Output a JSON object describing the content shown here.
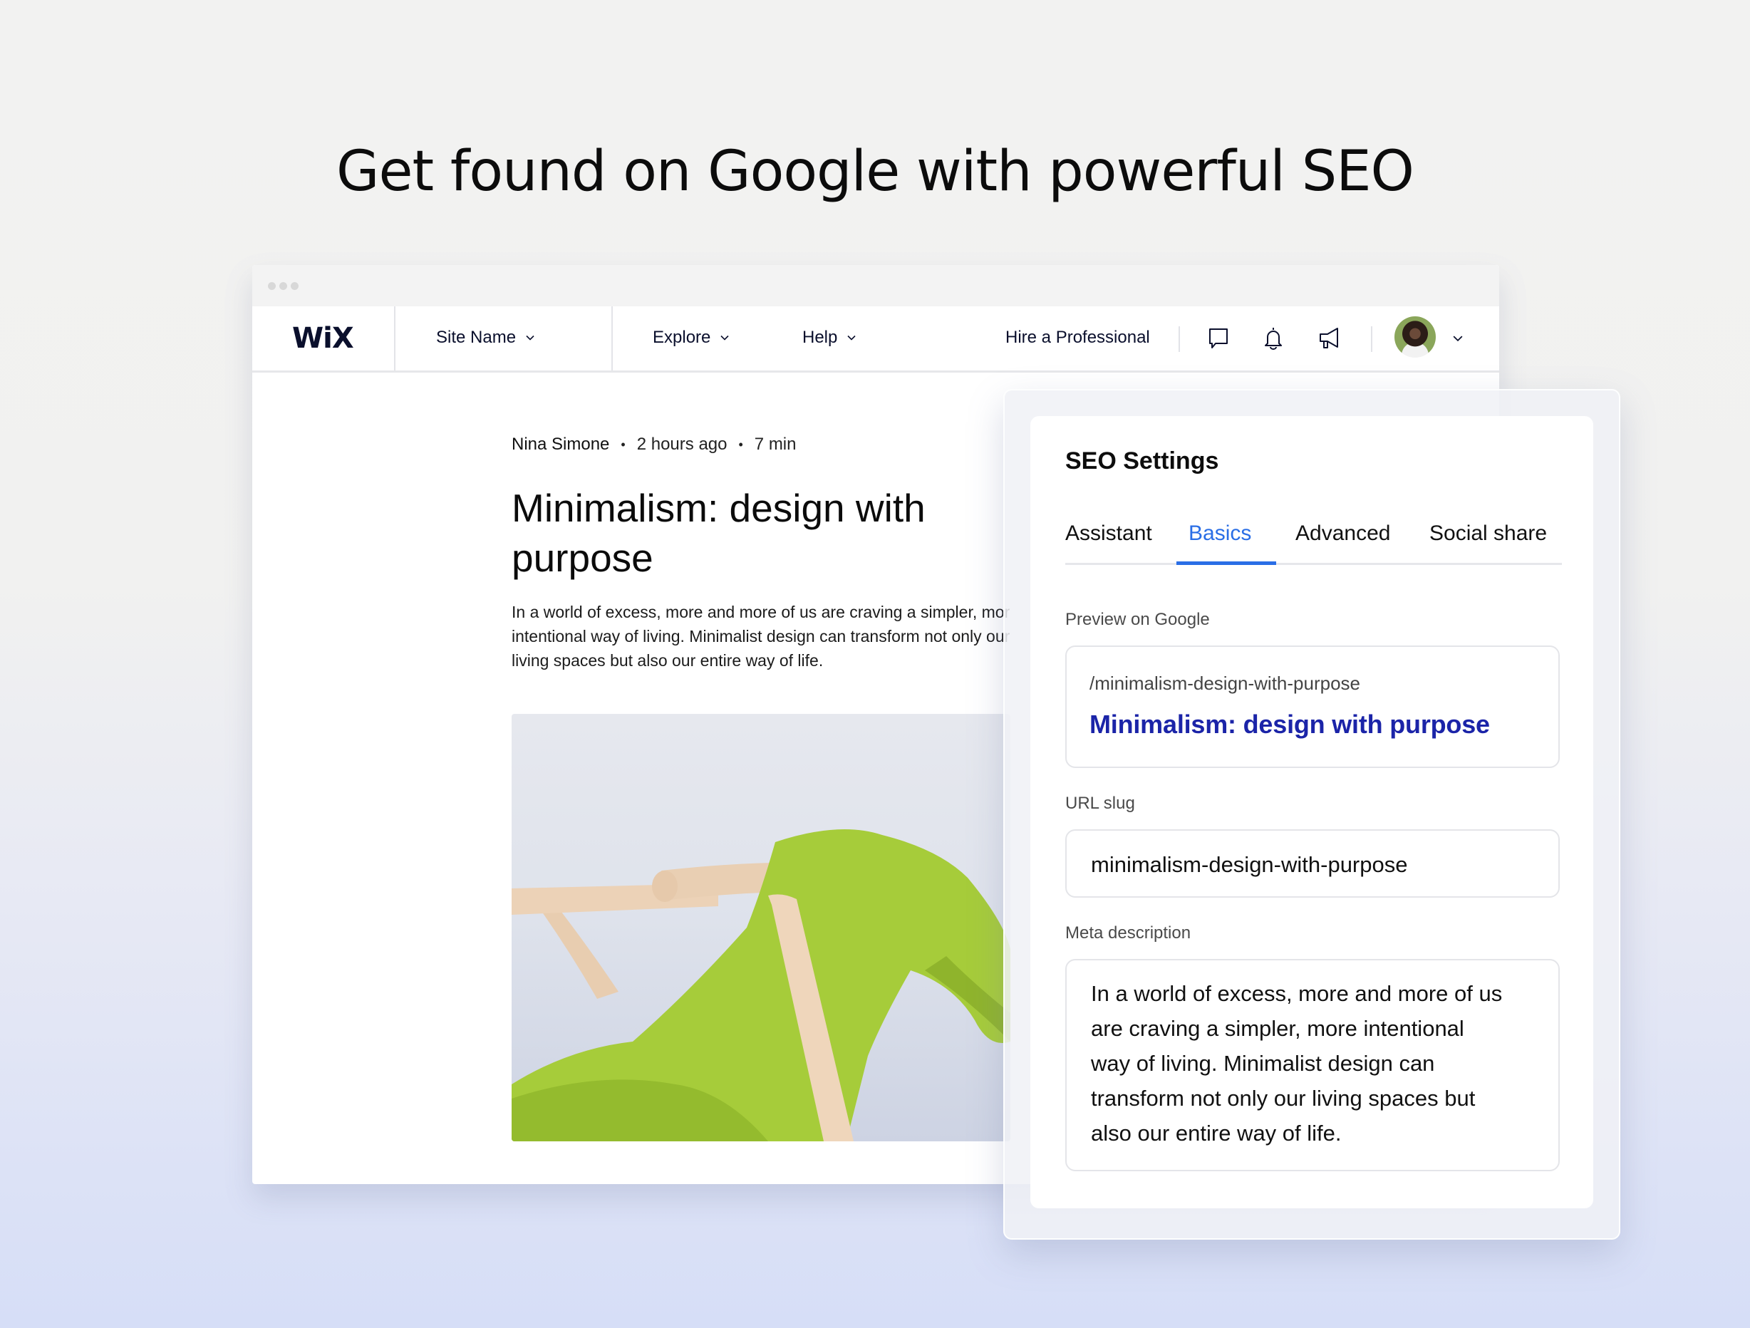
{
  "headline": "Get found on Google with powerful SEO",
  "browser": {
    "nav": {
      "logo": "WiX",
      "site_name": "Site Name",
      "explore": "Explore",
      "help": "Help",
      "hire": "Hire a Professional",
      "icons": [
        "chat-icon",
        "bell-icon",
        "megaphone-icon"
      ]
    },
    "article": {
      "author": "Nina Simone",
      "time": "2 hours ago",
      "read_time": "7 min",
      "bullet": "•",
      "title": "Minimalism: design with purpose",
      "body_lines": [
        "In a world of excess, more and more of us are craving a simpler, more",
        "intentional way of living. Minimalist design can transform not only our",
        "living spaces but also our entire way of life."
      ]
    }
  },
  "seo": {
    "title": "SEO Settings",
    "tabs": [
      "Assistant",
      "Basics",
      "Advanced",
      "Social share"
    ],
    "active_tab": "Basics",
    "preview_label": "Preview on Google",
    "preview_url": "/minimalism-design-with-purpose",
    "preview_title": "Minimalism: design with purpose",
    "slug_label": "URL slug",
    "slug_value": "minimalism-design-with-purpose",
    "meta_label": "Meta description",
    "meta_lines": [
      "In a world of excess, more and more of us",
      "are craving a simpler, more intentional",
      "way of living. Minimalist design can",
      "transform not only our living spaces but",
      "also our entire way of life."
    ]
  },
  "colors": {
    "accent_blue": "#2a6ee6",
    "link_blue": "#1b24a8",
    "nav_text": "#0a0f2c"
  }
}
